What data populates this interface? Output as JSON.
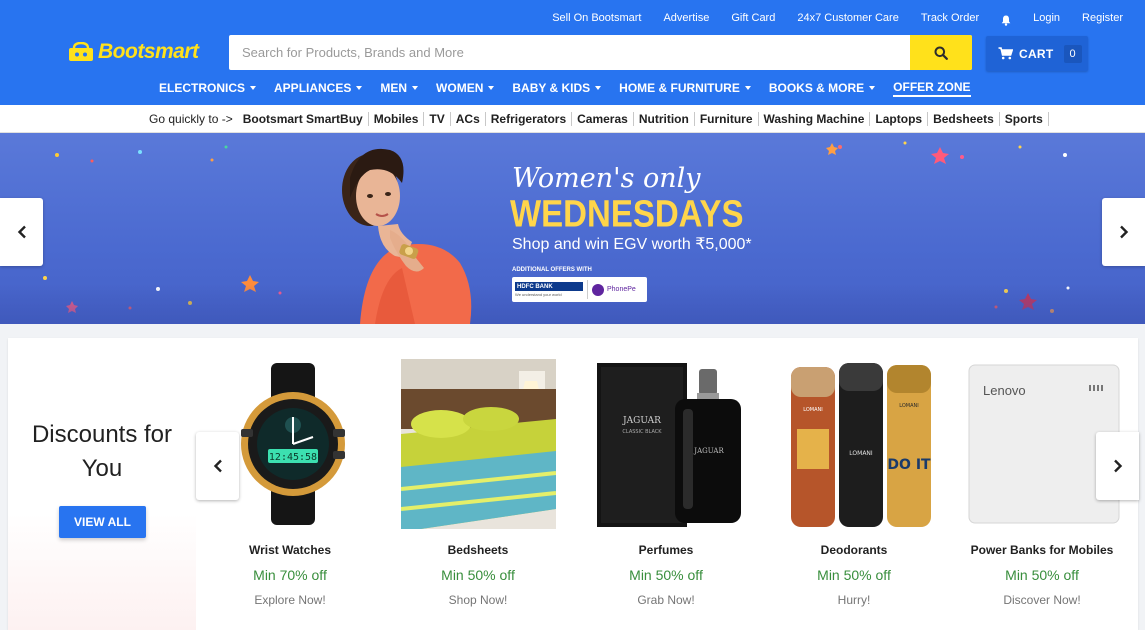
{
  "header": {
    "brand": "Bootsmart",
    "top_links": [
      "Sell On Bootsmart",
      "Advertise",
      "Gift Card",
      "24x7 Customer Care",
      "Track Order"
    ],
    "login": "Login",
    "register": "Register",
    "search_placeholder": "Search for Products, Brands and More",
    "search_value": "",
    "cart_label": "CART",
    "cart_count": "0",
    "categories": [
      "ELECTRONICS",
      "APPLIANCES",
      "MEN",
      "WOMEN",
      "BABY & KIDS",
      "HOME & FURNITURE",
      "BOOKS & MORE"
    ],
    "offer_zone": "OFFER ZONE"
  },
  "quickbar": {
    "label": "Go quickly to ->",
    "items": [
      "Bootsmart SmartBuy",
      "Mobiles",
      "TV",
      "ACs",
      "Refrigerators",
      "Cameras",
      "Nutrition",
      "Furniture",
      "Washing Machine",
      "Laptops",
      "Bedsheets",
      "Sports"
    ]
  },
  "banner": {
    "line1": "Women's only",
    "line2": "WEDNESDAYS",
    "line3": "Shop and win EGV worth ₹5,000*",
    "offers_label": "ADDITIONAL OFFERS WITH",
    "bank1": "HDFC BANK",
    "bank1_tag": "We understand your world",
    "bank2": "PhonePe"
  },
  "deals": {
    "title_line1": "Discounts for",
    "title_line2": "You",
    "view_all": "VIEW ALL",
    "items": [
      {
        "name": "Wrist Watches",
        "offer": "Min 70% off",
        "cta": "Explore Now!"
      },
      {
        "name": "Bedsheets",
        "offer": "Min 50% off",
        "cta": "Shop Now!"
      },
      {
        "name": "Perfumes",
        "offer": "Min 50% off",
        "cta": "Grab Now!"
      },
      {
        "name": "Deodorants",
        "offer": "Min 50% off",
        "cta": "Hurry!"
      },
      {
        "name": "Power Banks for Mobiles",
        "offer": "Min 50% off",
        "cta": "Discover Now!"
      }
    ],
    "image_texts": {
      "watch_digits": "12:45:58",
      "perfume_brand": "JAGUAR",
      "perfume_sub": "CLASSIC BLACK",
      "deo_brand": "LOMANI",
      "deo_label": "DO IT",
      "powerbank_brand": "Lenovo"
    }
  },
  "colors": {
    "brand_blue": "#2874f0",
    "brand_yellow": "#ffe11b",
    "offer_green": "#388e3c",
    "banner_blue": "#5073d6"
  }
}
